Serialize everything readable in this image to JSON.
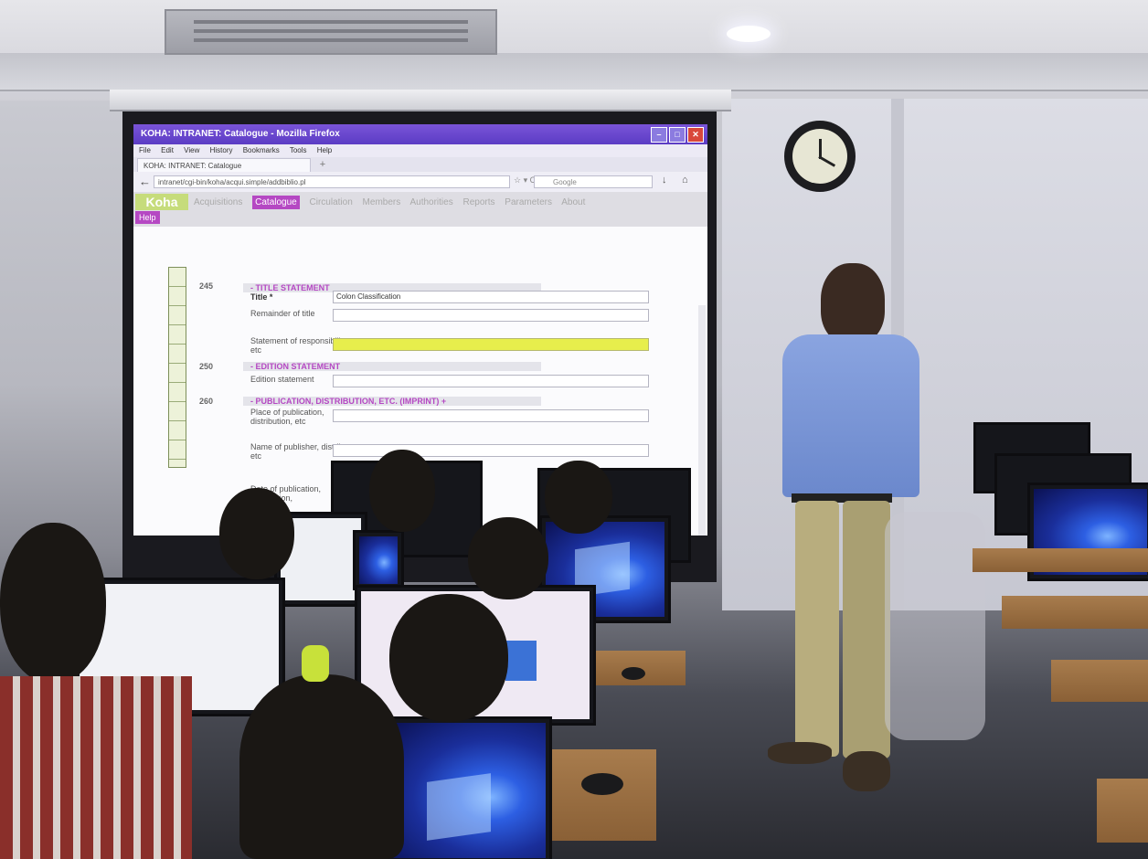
{
  "browser": {
    "title": "KOHA: INTRANET: Catalogue - Mozilla Firefox",
    "menu": [
      "File",
      "Edit",
      "View",
      "History",
      "Bookmarks",
      "Tools",
      "Help"
    ],
    "tab": "KOHA: INTRANET: Catalogue",
    "url": "intranet/cgi-bin/koha/acqui.simple/addbiblio.pl",
    "search_placeholder": "Google"
  },
  "koha": {
    "logo": "Koha",
    "nav": [
      "Acquisitions",
      "Catalogue",
      "Circulation",
      "Members",
      "Authorities",
      "Reports",
      "Parameters",
      "About"
    ],
    "active_nav": "Catalogue",
    "help": "Help"
  },
  "form": {
    "tag245": {
      "num": "245",
      "head": "- TITLE STATEMENT"
    },
    "title_label": "Title *",
    "title_value": "Colon Classification",
    "remainder_label": "Remainder of title",
    "statement_label": "Statement of responsibility, etc",
    "tag250": {
      "num": "250",
      "head": "- EDITION STATEMENT"
    },
    "edition_label": "Edition statement",
    "tag260": {
      "num": "260",
      "head": "- PUBLICATION, DISTRIBUTION, ETC. (IMPRINT) +"
    },
    "place_label": "Place of publication, distribution, etc",
    "publisher_label": "Name of publisher, distributor, etc",
    "date_label": "Date of publication, distribution,"
  },
  "colors": {
    "titlebar": "#5b3cc4",
    "koha_green": "#c6dc7b",
    "koha_purple": "#b548c3",
    "highlight_yellow": "#e7ee4c",
    "win10_blue": "#2d5fe3"
  }
}
